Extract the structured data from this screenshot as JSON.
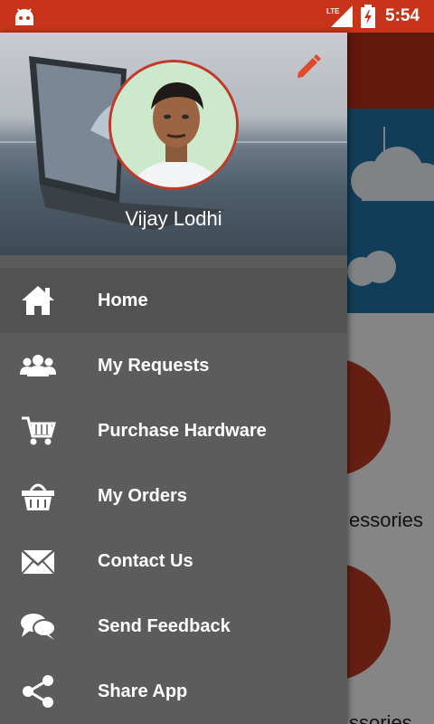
{
  "status_bar": {
    "network": "LTE",
    "time": "5:54"
  },
  "background_screen": {
    "category_label_1": "essories",
    "category_label_2": "ssories"
  },
  "drawer": {
    "user_name": "Vijay Lodhi",
    "menu_items": [
      {
        "label": "Home",
        "icon": "home-icon",
        "active": true
      },
      {
        "label": "My Requests",
        "icon": "users-icon",
        "active": false
      },
      {
        "label": "Purchase Hardware",
        "icon": "cart-icon",
        "active": false
      },
      {
        "label": "My Orders",
        "icon": "basket-icon",
        "active": false
      },
      {
        "label": "Contact Us",
        "icon": "mail-icon",
        "active": false
      },
      {
        "label": "Send Feedback",
        "icon": "chat-icon",
        "active": false
      },
      {
        "label": "Share App",
        "icon": "share-icon",
        "active": false
      }
    ]
  },
  "colors": {
    "status_bar": "#c8341a",
    "drawer_bg": "#5c5c5c",
    "active_item": "#525252",
    "accent": "#e04a2c"
  }
}
